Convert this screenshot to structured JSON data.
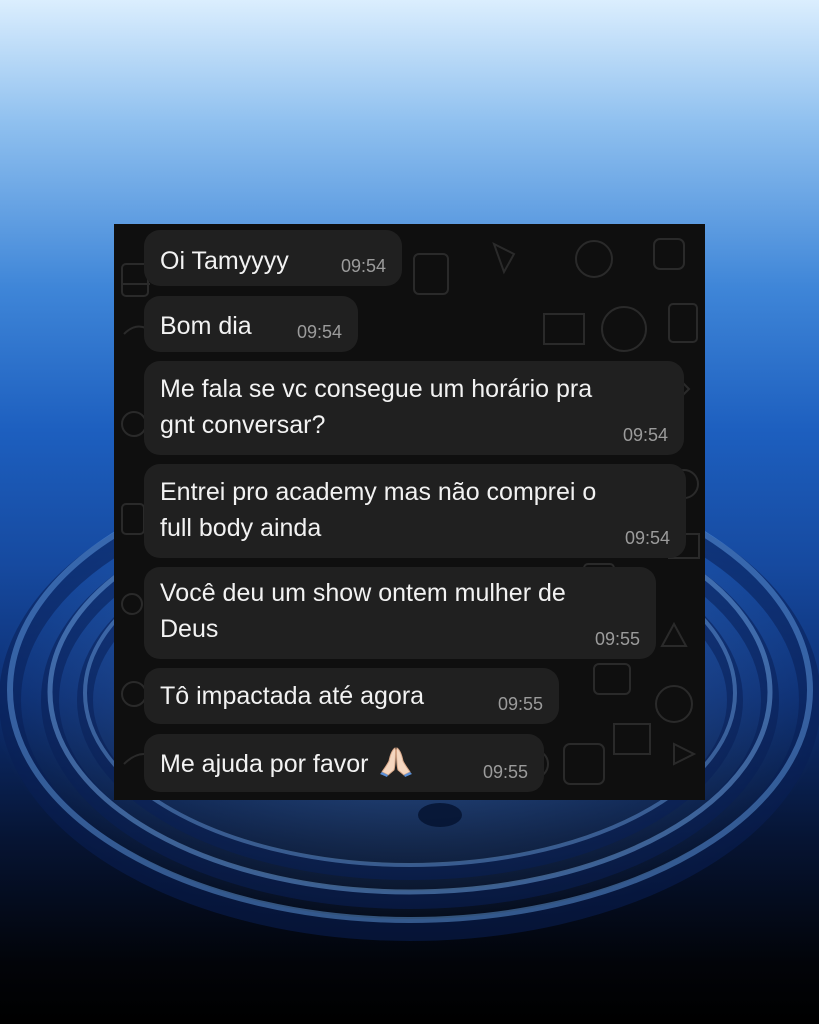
{
  "chat": {
    "messages": [
      {
        "text": "Oi Tamyyyy",
        "time": "09:54"
      },
      {
        "text": "Bom dia",
        "time": "09:54"
      },
      {
        "line1": "Me fala se vc consegue um horário pra",
        "line2": "gnt conversar?",
        "time": "09:54"
      },
      {
        "line1": "Entrei pro academy mas não comprei o",
        "line2": "full body ainda",
        "time": "09:54"
      },
      {
        "line1": "Você deu um show ontem mulher de",
        "line2": "Deus",
        "time": "09:55"
      },
      {
        "text": "Tô impactada até agora",
        "time": "09:55"
      },
      {
        "text": "Me ajuda por favor",
        "emoji": "folded-hands",
        "time": "09:55"
      }
    ]
  },
  "colors": {
    "bubble": "#202020",
    "panel": "#0f0f0f",
    "text": "#f2f2f2",
    "timestamp": "#9b9b9b"
  }
}
